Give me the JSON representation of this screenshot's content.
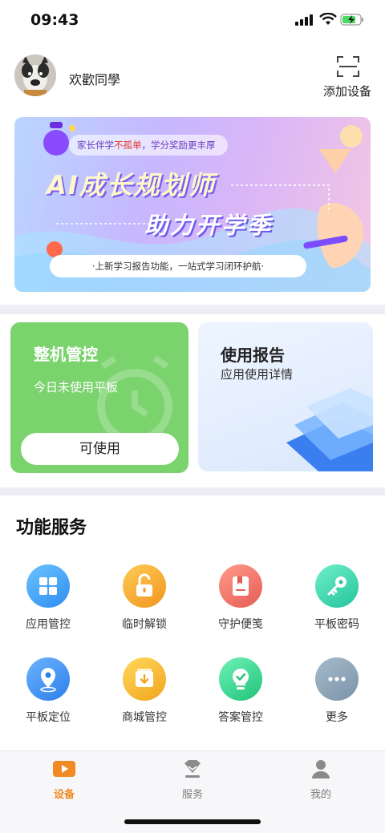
{
  "status_bar": {
    "time": "09:43"
  },
  "header": {
    "greeting": "欢歡同學",
    "add_device_label": "添加设备"
  },
  "banner": {
    "tagline_pre": "家长伴学",
    "tagline_highlight": "不孤单",
    "tagline_post": "，学分奖励更丰厚",
    "title_line1": "AI成长规划师",
    "title_line2": "助力开学季",
    "subtitle": "·上新学习报告功能，一站式学习闭环护航·"
  },
  "control_card": {
    "title": "整机管控",
    "status": "今日未使用平板",
    "button_label": "可使用"
  },
  "report_card": {
    "title": "使用报告",
    "subtitle": "应用使用详情"
  },
  "services": {
    "title": "功能服务",
    "items": [
      {
        "label": "应用管控",
        "icon": "app-grid-icon",
        "color": "#3aa0f5"
      },
      {
        "label": "临时解锁",
        "icon": "unlock-icon",
        "color": "#f5a623"
      },
      {
        "label": "守护便笺",
        "icon": "bookmark-note-icon",
        "color": "#f07b6a"
      },
      {
        "label": "平板密码",
        "icon": "key-icon",
        "color": "#3fd3b0"
      },
      {
        "label": "平板定位",
        "icon": "location-pin-icon",
        "color": "#3a8ff5"
      },
      {
        "label": "商城管控",
        "icon": "download-box-icon",
        "color": "#f5b82e"
      },
      {
        "label": "答案管控",
        "icon": "lightbulb-check-icon",
        "color": "#3ccf8e"
      },
      {
        "label": "更多",
        "icon": "more-dots-icon",
        "color": "#8ea5b8"
      }
    ]
  },
  "tabbar": {
    "items": [
      {
        "label": "设备",
        "icon": "play-screen-icon",
        "active": true
      },
      {
        "label": "服务",
        "icon": "diamond-service-icon",
        "active": false
      },
      {
        "label": "我的",
        "icon": "person-icon",
        "active": false
      }
    ],
    "active_color": "#f08a24",
    "inactive_color": "#7a7a7a"
  }
}
